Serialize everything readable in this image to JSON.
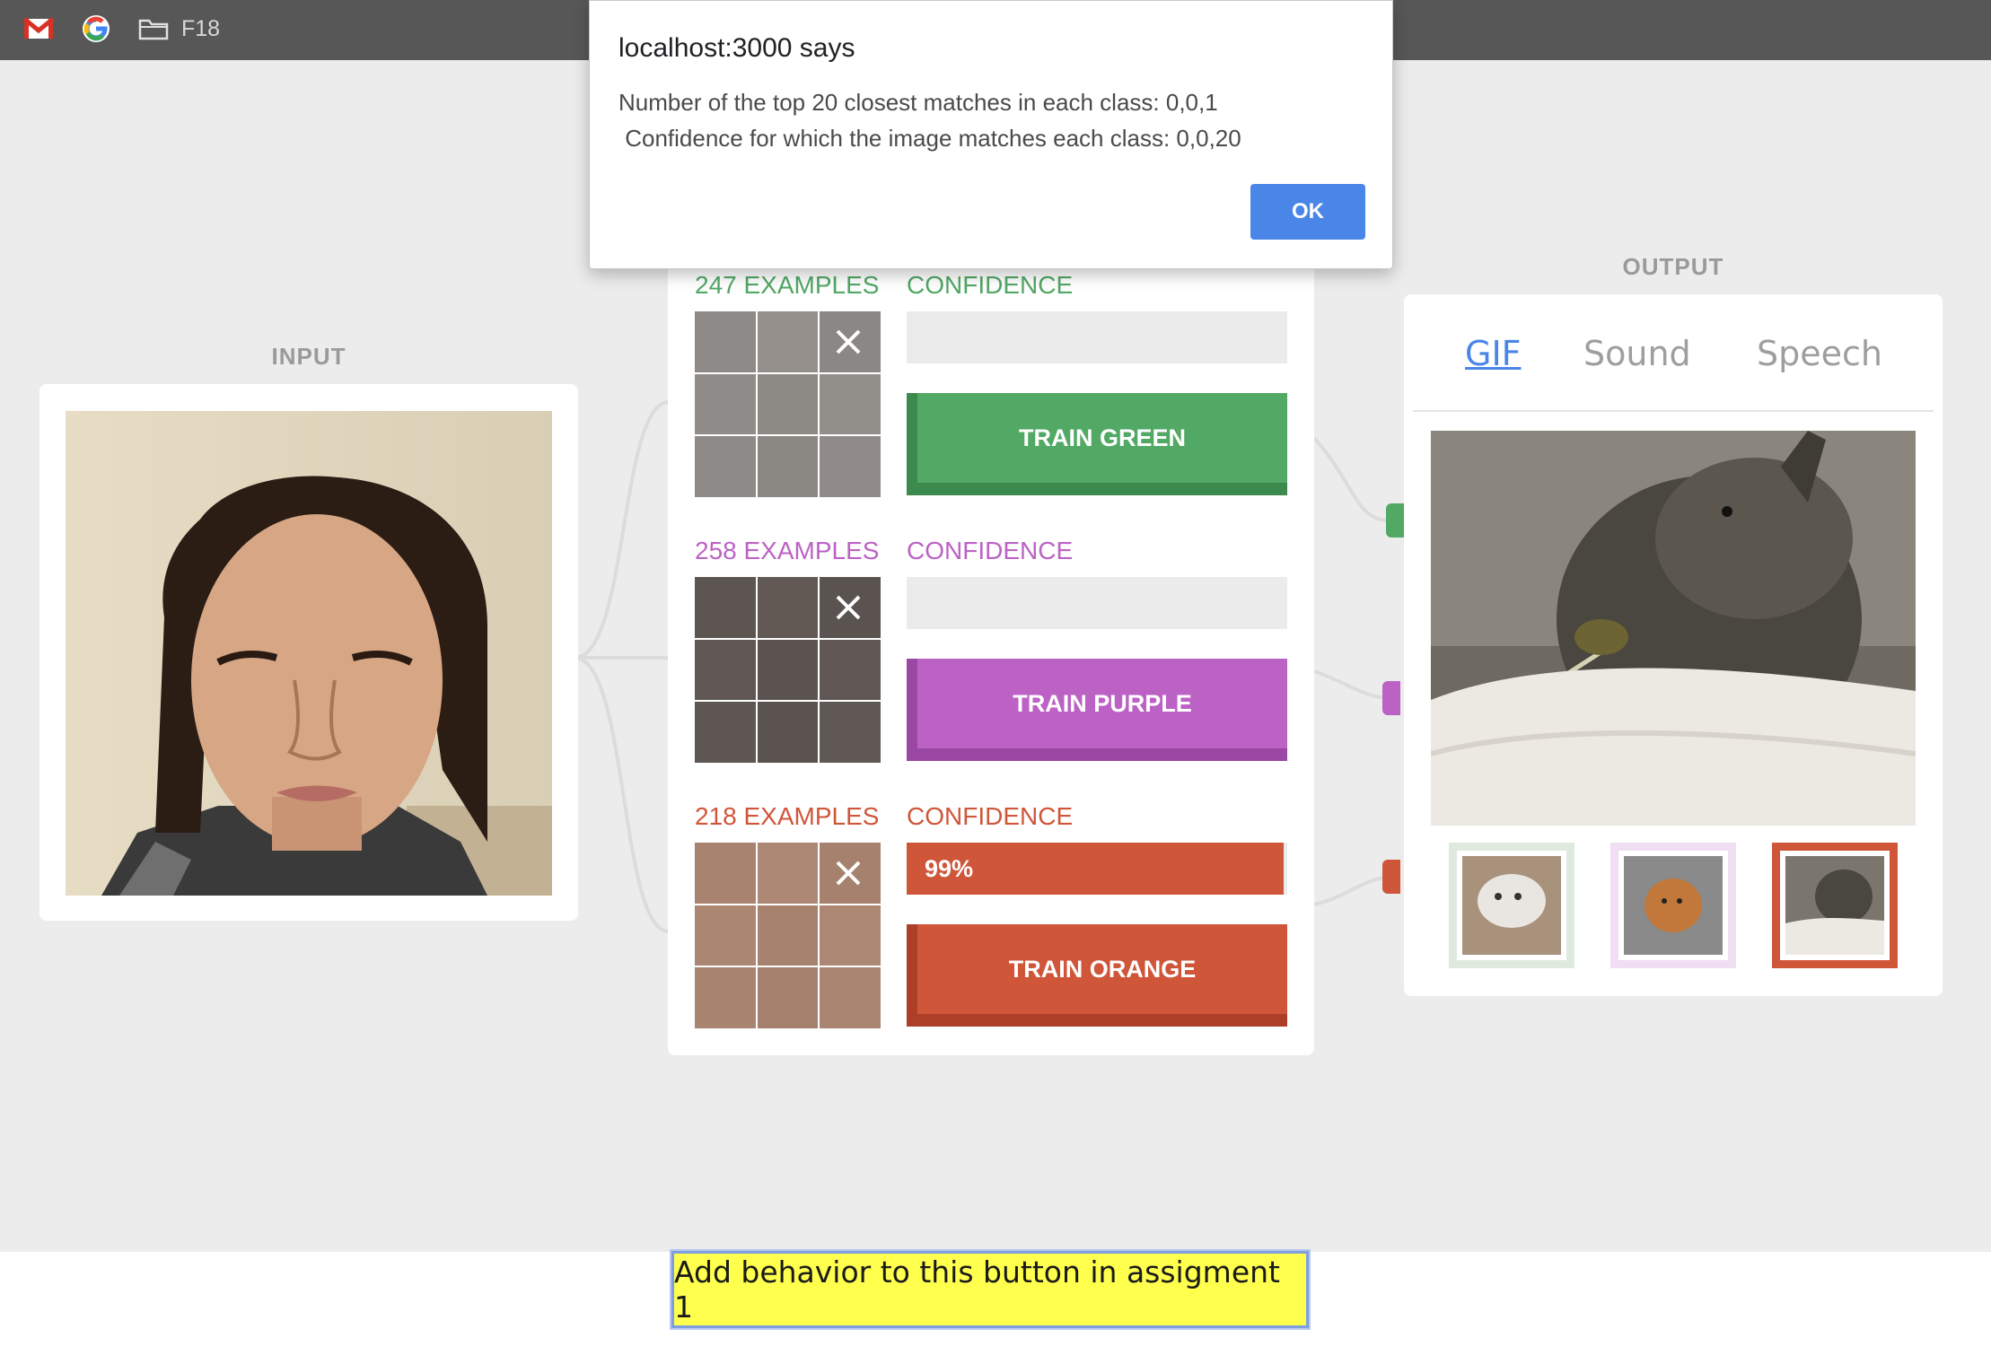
{
  "bookmarks": [
    {
      "icon": "gmail-icon",
      "label": ""
    },
    {
      "icon": "google-icon",
      "label": ""
    },
    {
      "icon": "folder-icon",
      "label": "F18"
    }
  ],
  "input": {
    "title": "INPUT"
  },
  "output": {
    "title": "OUTPUT",
    "tabs": [
      {
        "label": "GIF",
        "active": true
      },
      {
        "label": "Sound",
        "active": false
      },
      {
        "label": "Speech",
        "active": false
      }
    ],
    "selected_thumb": 2
  },
  "classes": [
    {
      "examples": "247 EXAMPLES",
      "confidence_label": "CONFIDENCE",
      "confidence_value": "",
      "confidence_pct": 0,
      "button": "TRAIN GREEN",
      "color": "#52a865",
      "dark": "#3d8a4f"
    },
    {
      "examples": "258 EXAMPLES",
      "confidence_label": "CONFIDENCE",
      "confidence_value": "",
      "confidence_pct": 0,
      "button": "TRAIN PURPLE",
      "color": "#bc62c5",
      "dark": "#9a48a3"
    },
    {
      "examples": "218 EXAMPLES",
      "confidence_label": "CONFIDENCE",
      "confidence_value": "99%",
      "confidence_pct": 99,
      "button": "TRAIN ORANGE",
      "color": "#d0563a",
      "dark": "#ad3f29"
    }
  ],
  "bottom_button": "Add behavior to this button in assigment 1",
  "dialog": {
    "title": "localhost:3000 says",
    "line1": "Number of the top 20 closest matches in each class: 0,0,1",
    "line2": " Confidence for which the image matches each class: 0,0,20",
    "ok": "OK"
  }
}
